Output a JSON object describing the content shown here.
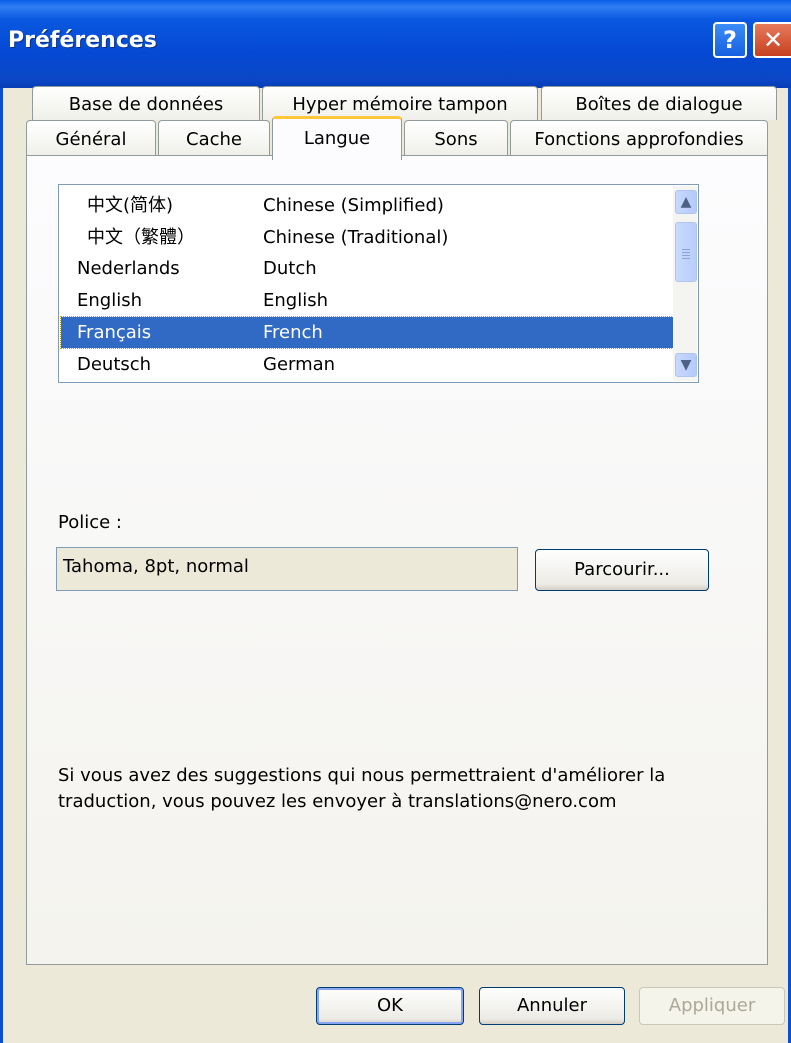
{
  "window": {
    "title": "Préférences"
  },
  "titlebar": {
    "help_label": "?",
    "close_label": "✕"
  },
  "tabs": {
    "row1": [
      "Base de données",
      "Hyper mémoire tampon",
      "Boîtes de dialogue"
    ],
    "row2": [
      "Général",
      "Cache",
      "Langue",
      "Sons",
      "Fonctions approfondies"
    ],
    "active": "Langue"
  },
  "languages": [
    {
      "native": "中文(简体)",
      "english": "Chinese (Simplified)",
      "selected": false
    },
    {
      "native": "中文（繁體）",
      "english": "Chinese (Traditional)",
      "selected": false
    },
    {
      "native": "Nederlands",
      "english": "Dutch",
      "selected": false
    },
    {
      "native": "English",
      "english": "English",
      "selected": false
    },
    {
      "native": "Français",
      "english": "French",
      "selected": true
    },
    {
      "native": "Deutsch",
      "english": "German",
      "selected": false
    }
  ],
  "font": {
    "label": "Police :",
    "value": "Tahoma, 8pt, normal",
    "browse_label": "Parcourir..."
  },
  "note": "Si vous avez des suggestions qui nous permettraient d'améliorer la traduction, vous pouvez les envoyer à translations@nero.com",
  "buttons": {
    "ok": "OK",
    "cancel": "Annuler",
    "apply": "Appliquer"
  },
  "colors": {
    "titlebar": "#0549d3",
    "selection": "#316ac5",
    "active_tab_accent": "#ffc83c",
    "face": "#ece9d8"
  }
}
